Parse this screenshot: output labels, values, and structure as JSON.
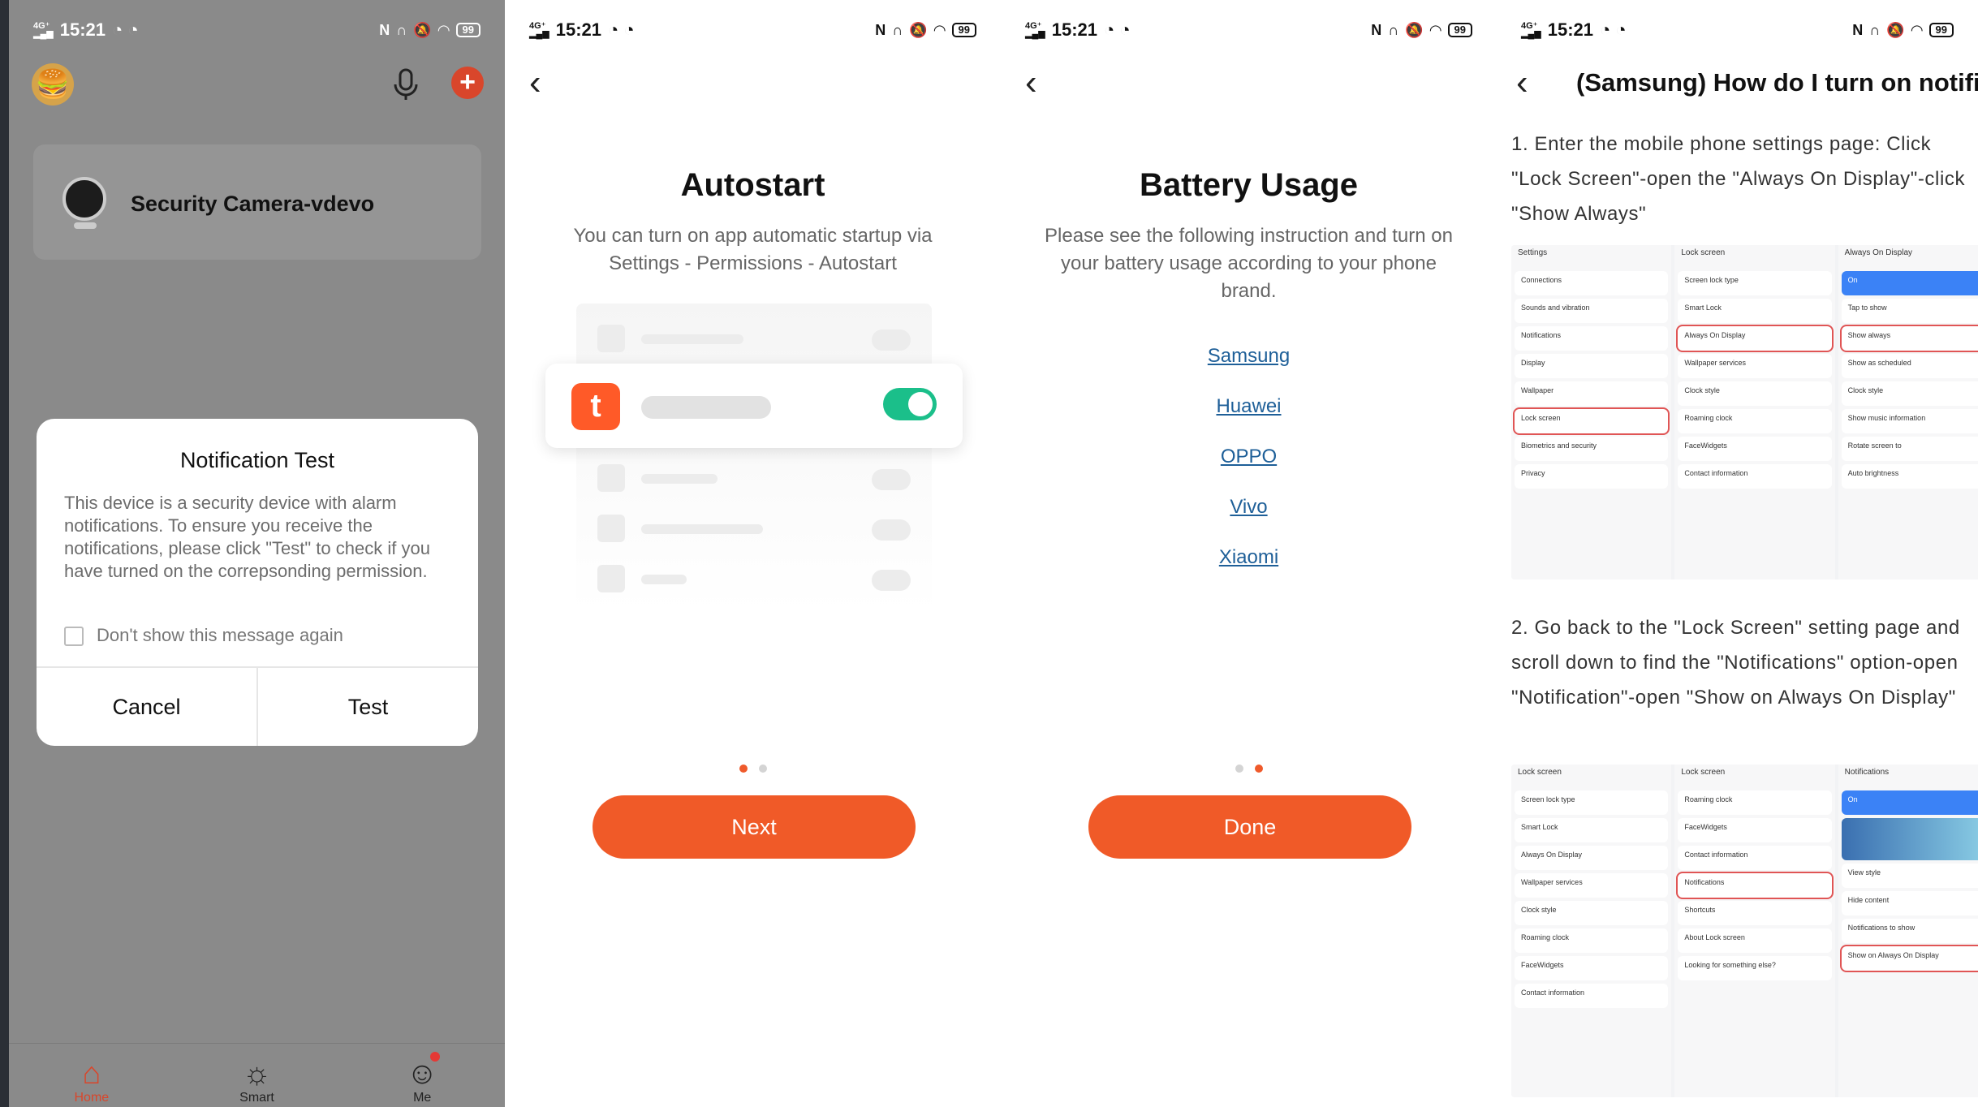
{
  "status_time": "15:21",
  "panel1": {
    "device_name": "Security Camera-vdevo",
    "dialog": {
      "title": "Notification Test",
      "body": "This device is a security device with alarm notifications. To ensure you receive the notifications, please click \"Test\" to check if you have turned on the correpsonding permission.",
      "checkbox_label": "Don't show this message again",
      "cancel_label": "Cancel",
      "test_label": "Test"
    },
    "tabs": [
      {
        "label": "Home",
        "icon": "home-icon"
      },
      {
        "label": "Smart",
        "icon": "sun-icon"
      },
      {
        "label": "Me",
        "icon": "person-icon"
      }
    ],
    "accent": "#d9462b"
  },
  "panel2": {
    "title": "Autostart",
    "subtitle": "You can turn on app automatic startup via Settings - Permissions - Autostart",
    "button": "Next",
    "page_indicator": {
      "current": 1,
      "total": 2
    }
  },
  "panel3": {
    "title": "Battery Usage",
    "subtitle": "Please see the following instruction and turn on your battery usage according to your phone brand.",
    "brands": [
      "Samsung",
      "Huawei",
      "OPPO",
      "Vivo",
      "Xiaomi"
    ],
    "button": "Done",
    "page_indicator": {
      "current": 2,
      "total": 2
    }
  },
  "panel4": {
    "title": "(Samsung) How do I turn on notifica",
    "step1": "1. Enter the mobile phone settings page: Click \"Lock Screen\"-open the \"Always On Display\"-click \"Show Always\"",
    "step2": "2. Go back to the \"Lock Screen\" setting page and scroll down to find the \"Notifications\" option-open \"Notification\"-open \"Show on Always On Display\"",
    "shot1": {
      "col1_header": "Settings",
      "col1_items": [
        "Connections",
        "Sounds and vibration",
        "Notifications",
        "Display",
        "Wallpaper",
        "Lock screen",
        "Biometrics and security",
        "Privacy"
      ],
      "col2_header": "Lock screen",
      "col2_items": [
        "Screen lock type",
        "Smart Lock",
        "Always On Display",
        "Wallpaper services",
        "Clock style",
        "Roaming clock",
        "FaceWidgets",
        "Contact information"
      ],
      "col3_header": "Always On Display",
      "col3_items": [
        "On",
        "Tap to show",
        "Show always",
        "Show as scheduled",
        "Clock style",
        "Show music information",
        "Rotate screen to",
        "Auto brightness"
      ]
    },
    "shot2": {
      "col1_header": "Lock screen",
      "col1_items": [
        "Screen lock type",
        "Smart Lock",
        "Always On Display",
        "Wallpaper services",
        "Clock style",
        "Roaming clock",
        "FaceWidgets",
        "Contact information"
      ],
      "col2_header": "Lock screen",
      "col2_items": [
        "Roaming clock",
        "FaceWidgets",
        "Contact information",
        "Notifications",
        "Shortcuts",
        "About Lock screen",
        "Looking for something else?"
      ],
      "col3_header": "Notifications",
      "col3_items": [
        "On",
        "View style",
        "Hide content",
        "Notifications to show",
        "Show on Always On Display"
      ]
    }
  }
}
